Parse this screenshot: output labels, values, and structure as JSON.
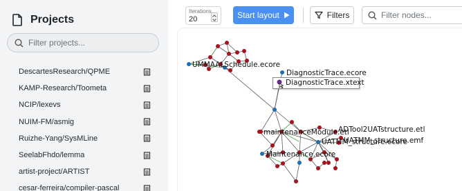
{
  "sidebar": {
    "title": "Projects",
    "search_placeholder": "Filter projects...",
    "projects": [
      {
        "label": "DescartesResearch/QPME"
      },
      {
        "label": "KAMP-Research/Toometa"
      },
      {
        "label": "NCIP/lexevs"
      },
      {
        "label": "NUIM-FM/asmig"
      },
      {
        "label": "Ruizhe-Yang/SysMLine"
      },
      {
        "label": "SeelabFhdo/lemma"
      },
      {
        "label": "artist-project/ARTIST"
      },
      {
        "label": "cesar-ferreira/compiler-pascal"
      }
    ]
  },
  "toolbar": {
    "iterations_label": "Iterations",
    "iterations_value": "20",
    "start_label": "Start layout",
    "filters_label": "Filters",
    "node_search_placeholder": "Filter nodes..."
  },
  "graph": {
    "labels": {
      "schedule": "UMMAALSchedule.ecore",
      "diagtrace": "DiagnosticTrace.ecore",
      "tooltip": "DiagnosticTrace.xtext",
      "adtool": "ADTool2UATstructure.etl",
      "maintmodule": "maintenanceModule.etl",
      "uatmm": "UATMM_structure.ecore",
      "uatmm_emf": "UATMM_structure.emf",
      "maintecore": "Maintenance.ecore"
    },
    "colors": {
      "file_node": "#a3141f",
      "model_node": "#1f6fb4",
      "focus_node": "#6a2c91",
      "edge": "#5a5a5a",
      "edge_green": "#4caf50"
    }
  }
}
